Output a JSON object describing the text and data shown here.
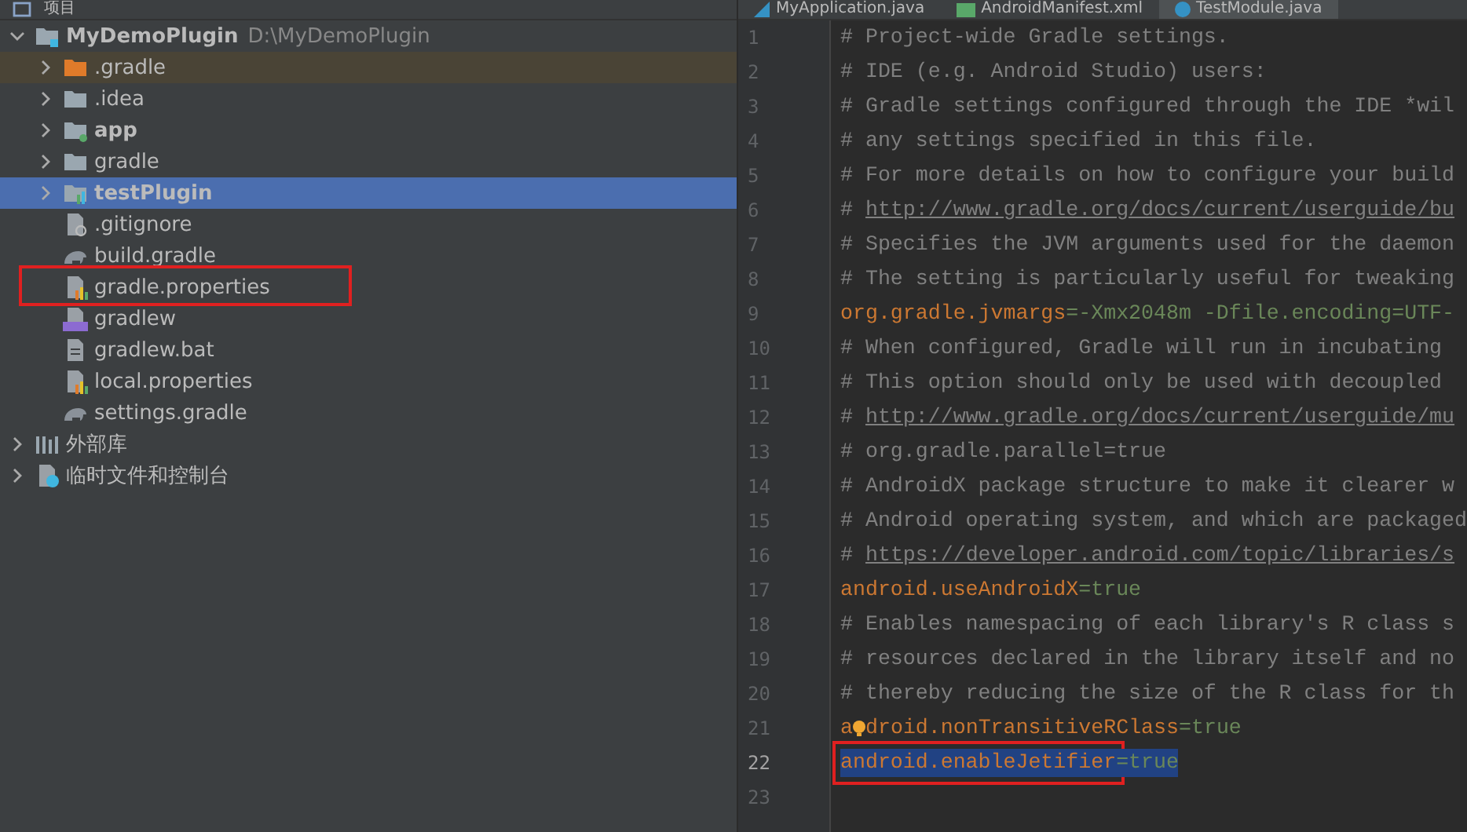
{
  "project_panel": {
    "title": "项目"
  },
  "editor_tabs": [
    {
      "label": "MyApplication.java",
      "selected": false,
      "kind": "java"
    },
    {
      "label": "AndroidManifest.xml",
      "selected": false,
      "kind": "manifest"
    },
    {
      "label": "TestModule.java",
      "selected": true,
      "kind": "java-class"
    }
  ],
  "tree": [
    {
      "name": "MyDemoPlugin",
      "path": "D:\\MyDemoPlugin",
      "kind": "project",
      "expanded": true,
      "selected": false,
      "marked": false,
      "children": [
        {
          "name": ".gradle",
          "kind": "excluded-folder",
          "expanded": false,
          "selected": false,
          "marked": false
        },
        {
          "name": ".idea",
          "kind": "folder",
          "expanded": false,
          "selected": false,
          "marked": false
        },
        {
          "name": "app",
          "kind": "module",
          "expanded": false,
          "selected": false,
          "marked": false
        },
        {
          "name": "gradle",
          "kind": "folder",
          "expanded": false,
          "selected": false,
          "marked": false
        },
        {
          "name": "testPlugin",
          "kind": "lib-module",
          "expanded": false,
          "selected": true,
          "marked": false
        },
        {
          "name": ".gitignore",
          "kind": "ignore-file",
          "selected": false,
          "marked": false
        },
        {
          "name": "build.gradle",
          "kind": "gradle-file",
          "selected": false,
          "marked": false
        },
        {
          "name": "gradle.properties",
          "kind": "properties-file",
          "selected": false,
          "marked": true
        },
        {
          "name": "gradlew",
          "kind": "script-file",
          "selected": false,
          "marked": false
        },
        {
          "name": "gradlew.bat",
          "kind": "text-file",
          "selected": false,
          "marked": false
        },
        {
          "name": "local.properties",
          "kind": "properties-file",
          "selected": false,
          "marked": false
        },
        {
          "name": "settings.gradle",
          "kind": "gradle-file",
          "selected": false,
          "marked": false
        }
      ]
    },
    {
      "name": "外部库",
      "kind": "library",
      "expanded": false,
      "selected": false,
      "marked": false
    },
    {
      "name": "临时文件和控制台",
      "kind": "scratch",
      "expanded": false,
      "selected": false,
      "marked": false
    }
  ],
  "editor_lines": [
    {
      "number": "1",
      "marked": false,
      "selected": false,
      "segments": [
        {
          "kind": "comment",
          "text": "# Project-wide Gradle settings."
        }
      ]
    },
    {
      "number": "2",
      "marked": false,
      "selected": false,
      "segments": [
        {
          "kind": "comment",
          "text": "# IDE (e.g. Android Studio) users:"
        }
      ]
    },
    {
      "number": "3",
      "marked": false,
      "selected": false,
      "segments": [
        {
          "kind": "comment",
          "text": "# Gradle settings configured through the IDE *wil"
        }
      ]
    },
    {
      "number": "4",
      "marked": false,
      "selected": false,
      "segments": [
        {
          "kind": "comment",
          "text": "# any settings specified in this file."
        }
      ]
    },
    {
      "number": "5",
      "marked": false,
      "selected": false,
      "segments": [
        {
          "kind": "comment",
          "text": "# For more details on how to configure your build"
        }
      ]
    },
    {
      "number": "6",
      "marked": false,
      "selected": false,
      "segments": [
        {
          "kind": "comment",
          "text": "# "
        },
        {
          "kind": "link",
          "text": "http://www.gradle.org/docs/current/userguide/bu"
        }
      ]
    },
    {
      "number": "7",
      "marked": false,
      "selected": false,
      "segments": [
        {
          "kind": "comment",
          "text": "# Specifies the JVM arguments used for the daemon"
        }
      ]
    },
    {
      "number": "8",
      "marked": false,
      "selected": false,
      "segments": [
        {
          "kind": "comment",
          "text": "# The setting is particularly useful for tweaking"
        }
      ]
    },
    {
      "number": "9",
      "marked": false,
      "selected": false,
      "segments": [
        {
          "kind": "key",
          "text": "org.gradle.jvmargs"
        },
        {
          "kind": "value",
          "text": "=-Xmx2048m -Dfile.encoding=UTF-"
        }
      ]
    },
    {
      "number": "10",
      "marked": false,
      "selected": false,
      "segments": [
        {
          "kind": "comment",
          "text": "# When configured, Gradle will run in incubating"
        }
      ]
    },
    {
      "number": "11",
      "marked": false,
      "selected": false,
      "segments": [
        {
          "kind": "comment",
          "text": "# This option should only be used with decoupled"
        }
      ]
    },
    {
      "number": "12",
      "marked": false,
      "selected": false,
      "segments": [
        {
          "kind": "comment",
          "text": "# "
        },
        {
          "kind": "link",
          "text": "http://www.gradle.org/docs/current/userguide/mu"
        }
      ]
    },
    {
      "number": "13",
      "marked": false,
      "selected": false,
      "segments": [
        {
          "kind": "comment",
          "text": "# org.gradle.parallel=true"
        }
      ]
    },
    {
      "number": "14",
      "marked": false,
      "selected": false,
      "segments": [
        {
          "kind": "comment",
          "text": "# AndroidX package structure to make it clearer w"
        }
      ]
    },
    {
      "number": "15",
      "marked": false,
      "selected": false,
      "segments": [
        {
          "kind": "comment",
          "text": "# Android operating system, and which are packaged"
        }
      ]
    },
    {
      "number": "16",
      "marked": false,
      "selected": false,
      "segments": [
        {
          "kind": "comment",
          "text": "# "
        },
        {
          "kind": "link",
          "text": "https://developer.android.com/topic/libraries/s"
        }
      ]
    },
    {
      "number": "17",
      "marked": false,
      "selected": false,
      "segments": [
        {
          "kind": "key",
          "text": "android.useAndroidX"
        },
        {
          "kind": "value",
          "text": "=true"
        }
      ]
    },
    {
      "number": "18",
      "marked": false,
      "selected": false,
      "segments": [
        {
          "kind": "comment",
          "text": "# Enables namespacing of each library's R class s"
        }
      ]
    },
    {
      "number": "19",
      "marked": false,
      "selected": false,
      "segments": [
        {
          "kind": "comment",
          "text": "# resources declared in the library itself and no"
        }
      ]
    },
    {
      "number": "20",
      "marked": false,
      "selected": false,
      "segments": [
        {
          "kind": "comment",
          "text": "# thereby reducing the size of the R class for th"
        }
      ]
    },
    {
      "number": "21",
      "marked": false,
      "selected": false,
      "bulb": true,
      "segments": [
        {
          "kind": "key",
          "text": "a"
        },
        {
          "kind": "key",
          "text": "droid.nonTransitiveRClass"
        },
        {
          "kind": "value",
          "text": "=true"
        }
      ]
    },
    {
      "number": "22",
      "marked": true,
      "selected": true,
      "segments": [
        {
          "kind": "key",
          "text": "android.enableJetifier"
        },
        {
          "kind": "value",
          "text": "=true"
        }
      ]
    },
    {
      "number": "23",
      "selected": false
    }
  ]
}
